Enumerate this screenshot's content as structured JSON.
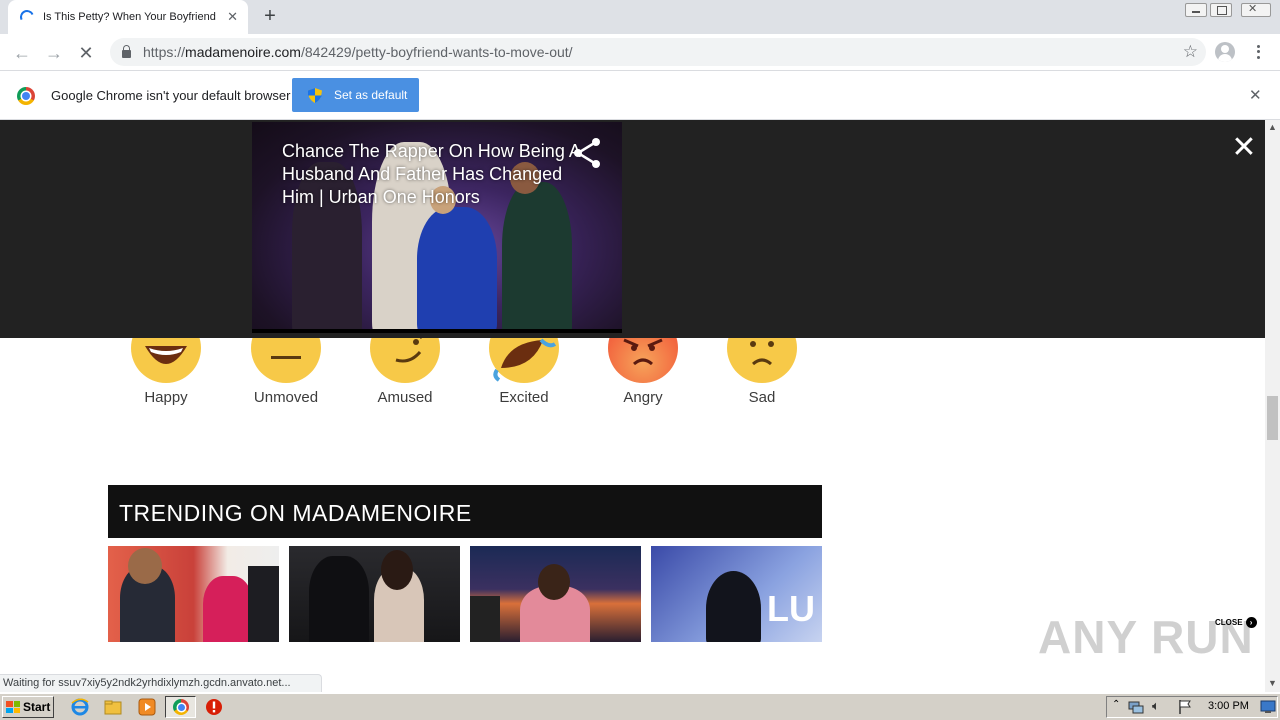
{
  "browser": {
    "tab_title": "Is This Petty? When Your Boyfriend",
    "url_domain": "madamenoire.com",
    "url_prefix": "https://",
    "url_path": "/842429/petty-boyfriend-wants-to-move-out/",
    "infobar_text": "Google Chrome isn't your default browser",
    "set_default_label": "Set as default",
    "status_text": "Waiting for ssuv7xiy5y2ndk2yrhdixlymzh.gcdn.anvato.net..."
  },
  "video": {
    "title": "Chance The Rapper On How Being A Husband And Father Has Changed Him | Urban One Honors"
  },
  "reactions": [
    {
      "label": "Happy",
      "icon": "grinning-face-icon",
      "color": "#f7c948"
    },
    {
      "label": "Unmoved",
      "icon": "neutral-face-icon",
      "color": "#f7c948"
    },
    {
      "label": "Amused",
      "icon": "smirk-face-icon",
      "color": "#f7c948"
    },
    {
      "label": "Excited",
      "icon": "rofl-face-icon",
      "color": "#f7c948"
    },
    {
      "label": "Angry",
      "icon": "angry-face-icon",
      "color": "#f2603c"
    },
    {
      "label": "Sad",
      "icon": "sad-face-icon",
      "color": "#f7c948"
    }
  ],
  "trending": {
    "title": "TRENDING ON MADAMENOIRE"
  },
  "ad": {
    "close_label": "CLOSE"
  },
  "watermark": "ANY RUN",
  "taskbar": {
    "start_label": "Start",
    "clock": "3:00 PM"
  },
  "colors": {
    "overlay": "#222222",
    "trend_bar": "#111111",
    "set_default_button": "#4a90e2"
  }
}
